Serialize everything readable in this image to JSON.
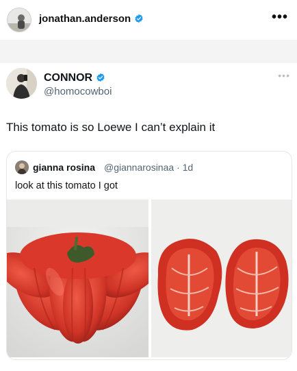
{
  "post_header": {
    "username": "jonathan.anderson",
    "more_icon": "more-horizontal-icon",
    "more_label": "•••"
  },
  "tweet": {
    "display_name": "CONNOR",
    "handle": "@homocowboi",
    "more_label": "•••",
    "text": "This tomato is so Loewe I can’t explain it",
    "verified_color": "#1d9bf0"
  },
  "quoted_tweet": {
    "display_name": "gianna rosina",
    "handle": "@giannarosinaa",
    "time": "· 1d",
    "text": "look at this tomato I got",
    "images": [
      "whole-heirloom-tomato-photo",
      "sliced-heirloom-tomato-photo"
    ]
  },
  "colors": {
    "tomato_red": "#d23a2c",
    "text_primary": "#0f1419",
    "text_secondary": "#536471"
  }
}
